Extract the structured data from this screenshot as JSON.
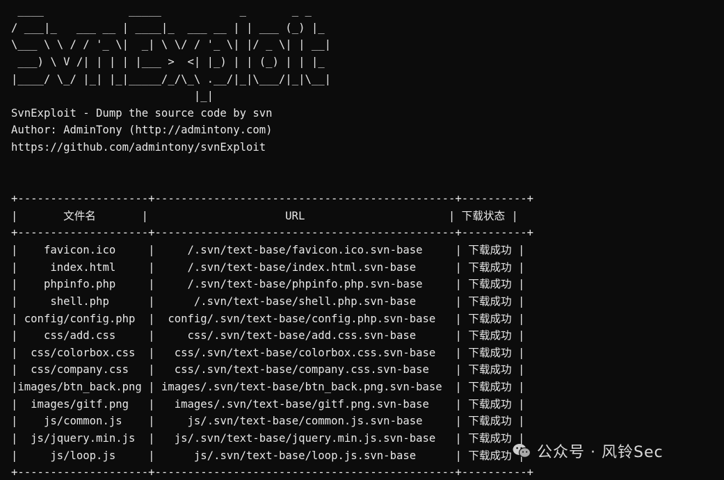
{
  "banner": [
    " ____             _____            _       _ _   ",
    "/ ___|_   ___ __ | ____|_  ___ __ | | ___ (_) |_ ",
    "\\___ \\ \\ / / '_ \\|  _| \\ \\/ / '_ \\| |/ _ \\| | __|",
    " ___) \\ V /| | | | |___ >  <| |_) | | (_) | | |_ ",
    "|____/ \\_/ |_| |_|_____/_/\\_\\ .__/|_|\\___/|_|\\__|",
    "                            |_|                  "
  ],
  "info": [
    "SvnExploit - Dump the source code by svn",
    "Author: AdminTony (http://admintony.com)",
    "https://github.com/admintony/svnExploit"
  ],
  "table": {
    "border": "+--------------------+----------------------------------------------+----------+",
    "headers": [
      "文件名",
      "URL",
      "下载状态"
    ],
    "rows": [
      [
        "favicon.ico",
        "/.svn/text-base/favicon.ico.svn-base",
        "下载成功"
      ],
      [
        "index.html",
        "/.svn/text-base/index.html.svn-base",
        "下载成功"
      ],
      [
        "phpinfo.php",
        "/.svn/text-base/phpinfo.php.svn-base",
        "下载成功"
      ],
      [
        "shell.php",
        "/.svn/text-base/shell.php.svn-base",
        "下载成功"
      ],
      [
        "config/config.php",
        "config/.svn/text-base/config.php.svn-base",
        "下载成功"
      ],
      [
        "css/add.css",
        "css/.svn/text-base/add.css.svn-base",
        "下载成功"
      ],
      [
        "css/colorbox.css",
        "css/.svn/text-base/colorbox.css.svn-base",
        "下载成功"
      ],
      [
        "css/company.css",
        "css/.svn/text-base/company.css.svn-base",
        "下载成功"
      ],
      [
        "images/btn_back.png",
        "images/.svn/text-base/btn_back.png.svn-base",
        "下载成功"
      ],
      [
        "images/gitf.png",
        "images/.svn/text-base/gitf.png.svn-base",
        "下载成功"
      ],
      [
        "js/common.js",
        "js/.svn/text-base/common.js.svn-base",
        "下载成功"
      ],
      [
        "js/jquery.min.js",
        "js/.svn/text-base/jquery.min.js.svn-base",
        "下载成功"
      ],
      [
        "js/loop.js",
        "js/.svn/text-base/loop.js.svn-base",
        "下载成功"
      ]
    ]
  },
  "watermark": {
    "text": "公众号 · 风铃Sec",
    "icon": "wechat-icon"
  },
  "colors": {
    "background": "#0c0c0c",
    "foreground": "#e8e8e8"
  }
}
